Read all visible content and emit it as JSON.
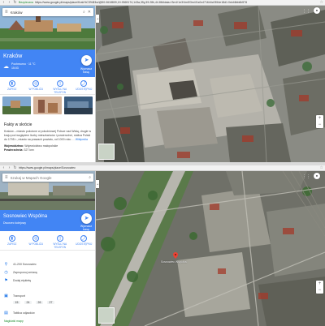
{
  "browser": {
    "security": "Bezpieczna",
    "url_top": "https://www.google.pl/maps/place/Krak%C3%B3w/@50.0618809,19.9369174,143a,35y,39.28h,44.86t/data=!3m1!1e3!4m5!3m4!1s0x471644c0354e18d1:0xb46bb6b576",
    "url_bottom": "https://www.google.pl/maps/place/Sosnowiec"
  },
  "top": {
    "search": {
      "value": "Kraków"
    },
    "place": {
      "name": "Kraków",
      "weather": "Pochmurno · 11 °C",
      "time": "15:03"
    },
    "directions_label": "Wyznacz trasę",
    "actions": [
      {
        "label": "ZAPISZ",
        "icon": "bookmark-icon"
      },
      {
        "label": "W POBLIŻU",
        "icon": "nearby-icon"
      },
      {
        "label": "WYŚLIJ NA TELEFON",
        "icon": "phone-icon"
      },
      {
        "label": "UDOSTĘPNIJ",
        "icon": "share-icon"
      }
    ],
    "facts": {
      "heading": "Fakty w skrócie",
      "description": "Kraków – miasto położone w południowej Polsce nad Wisłą, drugie w kraju pod względem liczby mieszkańców i powierzchni, stolica Polski do 1795 r., miasto na prawach powiatu, od 1000 roku …",
      "wiki_link": "Wikipedia",
      "voivodeship_label": "Województwo:",
      "voivodeship_value": "Województwo małopolskie",
      "area_label": "Powierzchnia:",
      "area_value": "327 km²"
    }
  },
  "bottom": {
    "search": {
      "placeholder": "Szukaj w Mapach Google"
    },
    "place": {
      "name": "Sosnowiec Wspólna",
      "sub": "Dworzec kolejowy"
    },
    "directions_label": "Wyznacz trasę",
    "actions": [
      {
        "label": "ZAPISZ",
        "icon": "bookmark-icon"
      },
      {
        "label": "W POBLIŻU",
        "icon": "nearby-icon"
      },
      {
        "label": "WYŚLIJ NA TELEFON",
        "icon": "phone-icon"
      },
      {
        "label": "UDOSTĘPNIJ",
        "icon": "share-icon"
      }
    ],
    "info": [
      {
        "icon": "location-icon",
        "text": "41-200 Sosnowiec"
      },
      {
        "icon": "clock-icon",
        "text": "Zaproponuj zmianę"
      },
      {
        "icon": "flag-icon",
        "text": "Dodaj etykietę"
      }
    ],
    "times_label": "Transport",
    "hours": [
      "15",
      "24",
      "26",
      "27"
    ],
    "departures_link": "Tablica odjazdów",
    "footer_link": "Nagłówki mapy"
  },
  "map_label_bottom": "Sosnowiec Wspólna",
  "colors": {
    "accent": "#4285f4",
    "pin": "#ea4335"
  }
}
